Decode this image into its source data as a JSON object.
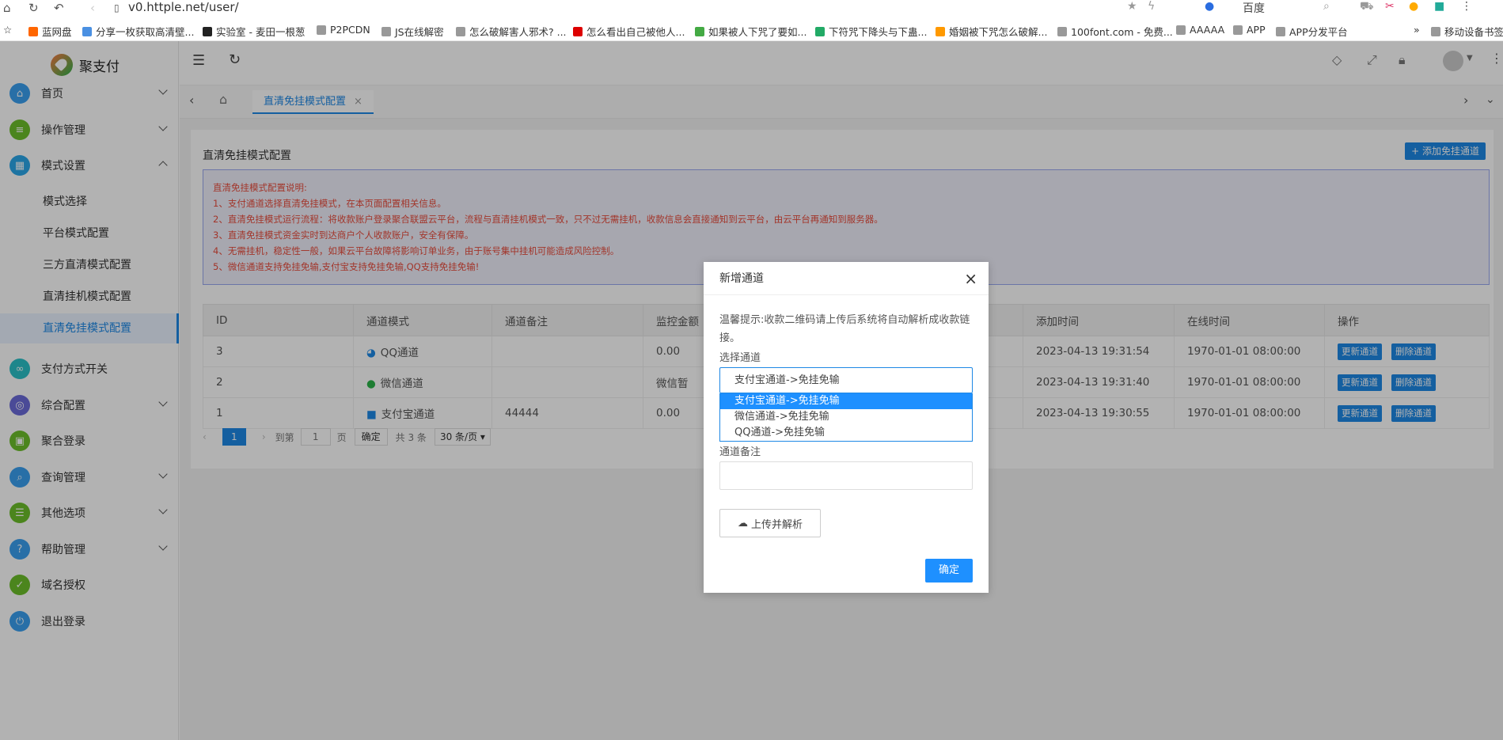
{
  "browser": {
    "url": "v0.httple.net/user/",
    "search_engine": "百度"
  },
  "bookmarks": [
    "蓝网盘",
    "分享一枚获取高清壁...",
    "实验室 - 麦田一根葱",
    "P2PCDN",
    "JS在线解密",
    "怎么破解害人邪术? ...",
    "怎么看出自己被他人...",
    "如果被人下咒了要如...",
    "下符咒下降头与下蛊...",
    "婚姻被下咒怎么破解...",
    "100font.com - 免费...",
    "AAAAA",
    "APP",
    "APP分发平台",
    "移动设备书签"
  ],
  "brand": "聚支付",
  "menu": [
    {
      "label": "首页",
      "color": "#3aa0f0",
      "icon": "⌂"
    },
    {
      "label": "操作管理",
      "color": "#6cbf2a",
      "icon": "≡"
    },
    {
      "label": "模式设置",
      "color": "#2aa6e8",
      "icon": "▦"
    },
    {
      "label": "支付方式开关",
      "color": "#2ac0c8",
      "icon": "∞"
    },
    {
      "label": "综合配置",
      "color": "#6a6ad8",
      "icon": "◎"
    },
    {
      "label": "聚合登录",
      "color": "#6cbf2a",
      "icon": "▣"
    },
    {
      "label": "查询管理",
      "color": "#3aa0f0",
      "icon": "⌕"
    },
    {
      "label": "其他选项",
      "color": "#6cbf2a",
      "icon": "☰"
    },
    {
      "label": "帮助管理",
      "color": "#3aa0f0",
      "icon": "?"
    },
    {
      "label": "域名授权",
      "color": "#6cbf2a",
      "icon": "✓"
    },
    {
      "label": "退出登录",
      "color": "#3aa0f0",
      "icon": "⏻"
    }
  ],
  "submenu": [
    "模式选择",
    "平台模式配置",
    "三方直清模式配置",
    "直清挂机模式配置",
    "直清免挂模式配置"
  ],
  "tab": "直清免挂模式配置",
  "panel": {
    "title": "直清免挂模式配置",
    "add_button": "+ 添加免挂通道"
  },
  "notice": [
    "直清免挂模式配置说明:",
    "1、支付通道选择直清免挂模式，在本页面配置相关信息。",
    "2、直清免挂模式运行流程：将收款账户登录聚合联盟云平台，流程与直清挂机模式一致，只不过无需挂机，收款信息会直接通知到云平台，由云平台再通知到服务器。",
    "3、直清免挂模式资金实时到达商户个人收款账户，安全有保障。",
    "4、无需挂机，稳定性一般，如果云平台故障将影响订单业务，由于账号集中挂机可能造成风险控制。",
    "5、微信通道支持免挂免输,支付宝支持免挂免输,QQ支持免挂免输!"
  ],
  "table": {
    "headers": [
      "ID",
      "通道模式",
      "通道备注",
      "监控金额",
      "",
      "",
      "添加时间",
      "在线时间",
      "操作"
    ],
    "rows": [
      {
        "id": "3",
        "mode": "QQ通道",
        "note": "",
        "amount": "0.00",
        "added": "2023-04-13 19:31:54",
        "online": "1970-01-01 08:00:00"
      },
      {
        "id": "2",
        "mode": "微信通道",
        "note": "",
        "amount": "微信暂",
        "added": "2023-04-13 19:31:40",
        "online": "1970-01-01 08:00:00"
      },
      {
        "id": "1",
        "mode": "支付宝通道",
        "note": "44444",
        "amount": "0.00",
        "added": "2023-04-13 19:30:55",
        "online": "1970-01-01 08:00:00"
      }
    ],
    "update_label": "更新通道",
    "delete_label": "删除通道"
  },
  "pagination": {
    "page": "1",
    "goto": "到第",
    "page_input": "1",
    "page_unit": "页",
    "confirm": "确定",
    "total": "共 3 条",
    "per_page": "30 条/页"
  },
  "modal": {
    "title": "新增通道",
    "tip": "温馨提示:收款二维码请上传后系统将自动解析成收款链接。",
    "select_label": "选择通道",
    "selected": "支付宝通道->免挂免输",
    "options": [
      "支付宝通道->免挂免输",
      "微信通道->免挂免输",
      "QQ通道->免挂免输"
    ],
    "note_label": "通道备注",
    "upload": "上传并解析",
    "confirm": "确定"
  }
}
